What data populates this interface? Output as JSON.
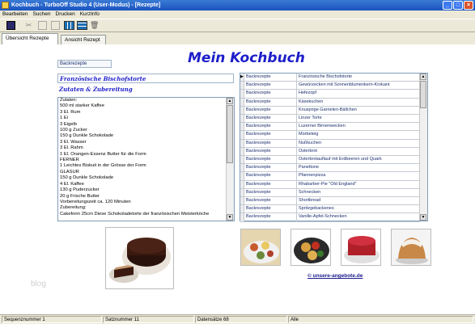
{
  "window": {
    "title": "Kochbuch - TurboOff Studio 4 (User-Modus) - [Rezepte]"
  },
  "menu": {
    "items": [
      "Bearbeiten",
      "Suchen",
      "Drucken",
      "KurzInfo"
    ]
  },
  "toolbar": {
    "icons": [
      "book-icon",
      "cut-icon",
      "copy-icon",
      "paste-icon",
      "grid-view-icon",
      "table-view-icon",
      "trash-icon"
    ]
  },
  "tabs": [
    {
      "label": "Übersicht Rezepte",
      "active": true
    },
    {
      "label": "Ansicht Rezept",
      "active": false
    }
  ],
  "main": {
    "title": "Mein Kochbuch",
    "category": "Backrezepte",
    "recipe_title": "Französische Bischofstorte",
    "section_heading": "Zutaten & Zubereitung",
    "ingredients": [
      "Zutaten:",
      "500 ml starker Kaffee",
      "3 El. Rum",
      "1 Ei",
      "3 Eigelb",
      "100 g Zucker",
      "150 g Dunkle Schokolade",
      "3 El. Wasser",
      "3 El. Rahm",
      "1 El. Orangen-Essenz Butter für die Form",
      "FERNER",
      "1 Leichtes Biskuit in der Grösse der Form",
      "GLASUR",
      "150 g Dunkle Schokolade",
      "4 El. Kaffee",
      "130 g Puderzucker",
      "20 g Frische Butter",
      "Vorbereitungszeit ca. 120 Minuten",
      "Zubereitung:",
      "Cakeform 25cm Diese Schokoladetorte der französischen Meisterköche"
    ],
    "recipe_list": [
      {
        "category": "Backrezepte",
        "name": "Französische Bischofstorte",
        "selected": true
      },
      {
        "category": "Backrezepte",
        "name": "Gewürzecken mit Sonnenblumenkern-Krokant"
      },
      {
        "category": "Backrezepte",
        "name": "Hefezopf"
      },
      {
        "category": "Backrezepte",
        "name": "Käsekuchen"
      },
      {
        "category": "Backrezepte",
        "name": "Knusprige Garnelen-Bällchen"
      },
      {
        "category": "Backrezepte",
        "name": "Linzer Torte"
      },
      {
        "category": "Backrezepte",
        "name": "Luzerner Birnenwecken"
      },
      {
        "category": "Backrezepte",
        "name": "Mürbeteig"
      },
      {
        "category": "Backrezepte",
        "name": "Nußkuchen"
      },
      {
        "category": "Backrezepte",
        "name": "Osterbrot"
      },
      {
        "category": "Backrezepte",
        "name": "Osterbrotauflauf mit Erdbeeren und Quark"
      },
      {
        "category": "Backrezepte",
        "name": "Panettone"
      },
      {
        "category": "Backrezepte",
        "name": "Pfannenpizza"
      },
      {
        "category": "Backrezepte",
        "name": "Rhabarber-Pie \"Old England\""
      },
      {
        "category": "Backrezepte",
        "name": "Schnecken"
      },
      {
        "category": "Backrezepte",
        "name": "Shortbread"
      },
      {
        "category": "Backrezepte",
        "name": "Spritzgebackenes"
      },
      {
        "category": "Backrezepte",
        "name": "Vanille-Apfel-Schnecken"
      }
    ],
    "link": "© unsere-angebote.de",
    "watermark": "blog"
  },
  "status": {
    "sequence": "Sequenznummer 1",
    "record": "Satznummer 11",
    "count": "Datensätze 68",
    "filter": "Alle"
  },
  "colors": {
    "title_blue": "#1c1ec9",
    "titlebar": "#1a53c0"
  }
}
